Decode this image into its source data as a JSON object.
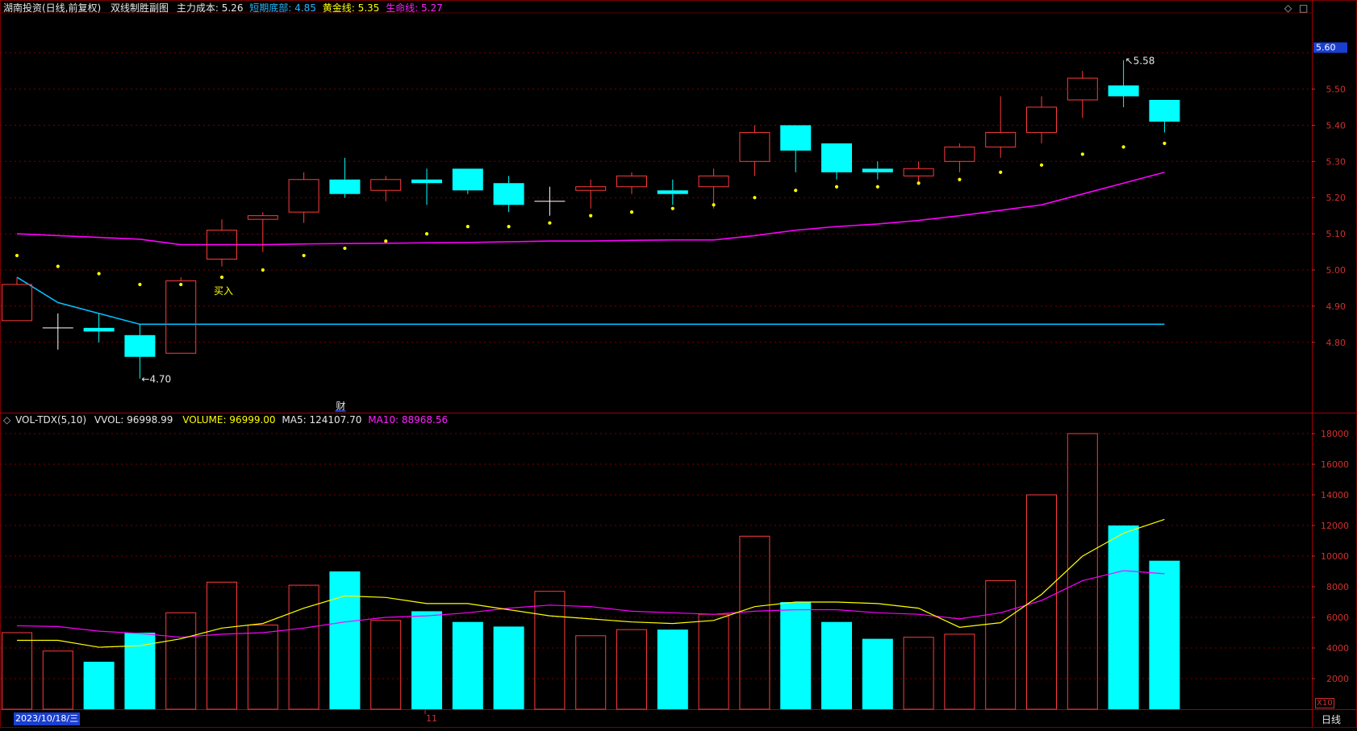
{
  "header": {
    "stock": "湖南投资(日线,前复权)",
    "indicator": "双线制胜副图",
    "cost_label": "主力成本:",
    "cost_value": "5.26",
    "bottom_label": "短期底部:",
    "bottom_value": "4.85",
    "gold_label": "黄金线:",
    "gold_value": "5.35",
    "life_label": "生命线:",
    "life_value": "5.27"
  },
  "window_controls": {
    "diamond": "◇",
    "box": "□"
  },
  "vol_header": {
    "icon": "◇",
    "name": "VOL-TDX(5,10)",
    "vvol": "VVOL: 96998.99",
    "volume": "VOLUME: 96999.00",
    "ma5": "MA5: 124107.70",
    "ma10": "MA10: 88968.56"
  },
  "footer": {
    "date_box": "2023/10/18/三",
    "month_tick": "11",
    "period": "日线",
    "multiplier": "X10"
  },
  "colors": {
    "up": "#ff3b3b",
    "down": "#00ffff",
    "life_line": "#ff00ff",
    "bottom_line": "#00bfff",
    "gold_dot": "#ffff00",
    "ma5": "#ffff00",
    "ma10": "#ff00ff",
    "grid": "#7a0000",
    "axis_text": "#d03030"
  },
  "chart_data": [
    {
      "type": "candlestick",
      "title": "双线制胜副图",
      "ylim": [
        4.7,
        5.62
      ],
      "y_ticks": [
        4.8,
        4.9,
        5.0,
        5.1,
        5.2,
        5.3,
        5.4,
        5.5
      ],
      "current_price_label": "5.60",
      "candles": [
        {
          "o": 4.86,
          "h": 4.98,
          "l": 4.86,
          "c": 4.96
        },
        {
          "o": 4.84,
          "h": 4.88,
          "l": 4.78,
          "c": 4.84
        },
        {
          "o": 4.84,
          "h": 4.88,
          "l": 4.8,
          "c": 4.83
        },
        {
          "o": 4.82,
          "h": 4.85,
          "l": 4.7,
          "c": 4.76
        },
        {
          "o": 4.77,
          "h": 4.98,
          "l": 4.77,
          "c": 4.97
        },
        {
          "o": 5.03,
          "h": 5.14,
          "l": 5.01,
          "c": 5.11
        },
        {
          "o": 5.14,
          "h": 5.16,
          "l": 5.05,
          "c": 5.15
        },
        {
          "o": 5.16,
          "h": 5.27,
          "l": 5.13,
          "c": 5.25
        },
        {
          "o": 5.25,
          "h": 5.31,
          "l": 5.2,
          "c": 5.21
        },
        {
          "o": 5.22,
          "h": 5.26,
          "l": 5.19,
          "c": 5.25
        },
        {
          "o": 5.25,
          "h": 5.28,
          "l": 5.18,
          "c": 5.24
        },
        {
          "o": 5.28,
          "h": 5.28,
          "l": 5.21,
          "c": 5.22
        },
        {
          "o": 5.24,
          "h": 5.26,
          "l": 5.16,
          "c": 5.18
        },
        {
          "o": 5.19,
          "h": 5.23,
          "l": 5.15,
          "c": 5.19
        },
        {
          "o": 5.22,
          "h": 5.25,
          "l": 5.17,
          "c": 5.23
        },
        {
          "o": 5.23,
          "h": 5.27,
          "l": 5.21,
          "c": 5.26
        },
        {
          "o": 5.22,
          "h": 5.25,
          "l": 5.18,
          "c": 5.21
        },
        {
          "o": 5.23,
          "h": 5.28,
          "l": 5.17,
          "c": 5.26
        },
        {
          "o": 5.3,
          "h": 5.4,
          "l": 5.26,
          "c": 5.38
        },
        {
          "o": 5.4,
          "h": 5.4,
          "l": 5.27,
          "c": 5.33
        },
        {
          "o": 5.35,
          "h": 5.35,
          "l": 5.25,
          "c": 5.27
        },
        {
          "o": 5.28,
          "h": 5.3,
          "l": 5.25,
          "c": 5.27
        },
        {
          "o": 5.26,
          "h": 5.3,
          "l": 5.24,
          "c": 5.28
        },
        {
          "o": 5.3,
          "h": 5.35,
          "l": 5.27,
          "c": 5.34
        },
        {
          "o": 5.34,
          "h": 5.48,
          "l": 5.31,
          "c": 5.38
        },
        {
          "o": 5.38,
          "h": 5.48,
          "l": 5.35,
          "c": 5.45
        },
        {
          "o": 5.47,
          "h": 5.55,
          "l": 5.42,
          "c": 5.53
        },
        {
          "o": 5.51,
          "h": 5.58,
          "l": 5.45,
          "c": 5.48
        },
        {
          "o": 5.47,
          "h": 5.47,
          "l": 5.38,
          "c": 5.41
        }
      ],
      "gold_dots": [
        5.04,
        5.01,
        4.99,
        4.96,
        4.96,
        4.98,
        5.0,
        5.04,
        5.06,
        5.08,
        5.1,
        5.12,
        5.12,
        5.13,
        5.15,
        5.16,
        5.17,
        5.18,
        5.2,
        5.22,
        5.23,
        5.23,
        5.24,
        5.25,
        5.27,
        5.29,
        5.32,
        5.34,
        5.35
      ],
      "life_line": [
        5.1,
        5.095,
        5.09,
        5.085,
        5.07,
        5.07,
        5.07,
        5.072,
        5.073,
        5.074,
        5.075,
        5.076,
        5.078,
        5.08,
        5.08,
        5.082,
        5.083,
        5.083,
        5.095,
        5.11,
        5.12,
        5.127,
        5.137,
        5.15,
        5.165,
        5.18,
        5.21,
        5.24,
        5.27
      ],
      "bottom_line": [
        4.98,
        4.91,
        4.88,
        4.85,
        4.85,
        4.85,
        4.85,
        4.85,
        4.85,
        4.85,
        4.85,
        4.85,
        4.85,
        4.85,
        4.85,
        4.85,
        4.85,
        4.85,
        4.85,
        4.85,
        4.85,
        4.85,
        4.85,
        4.85,
        4.85,
        4.85,
        4.85,
        4.85,
        4.85
      ],
      "annotations": {
        "low_label": "4.70",
        "high_label": "5.58",
        "buy_label": "买入",
        "cai_label": "财"
      }
    },
    {
      "type": "bar",
      "title": "VOL-TDX(5,10)",
      "ylim": [
        0,
        18600
      ],
      "y_ticks": [
        2000,
        4000,
        6000,
        8000,
        10000,
        12000,
        14000,
        16000,
        18000
      ],
      "volumes": [
        5000,
        3800,
        3100,
        5000,
        6300,
        8300,
        5500,
        8100,
        9000,
        5800,
        6400,
        5700,
        5400,
        7700,
        4800,
        5200,
        5200,
        6200,
        11300,
        7000,
        5700,
        4600,
        4700,
        4900,
        8400,
        14000,
        18000,
        12000,
        9700
      ],
      "ma5": [
        4500,
        4500,
        4050,
        4150,
        4600,
        5300,
        5600,
        6600,
        7400,
        7300,
        6900,
        6900,
        6500,
        6100,
        5900,
        5700,
        5600,
        5800,
        6700,
        7000,
        7000,
        6900,
        6600,
        5350,
        5650,
        7500,
        10000,
        11500,
        12400
      ],
      "ma10": [
        5450,
        5400,
        5100,
        4950,
        4700,
        4900,
        5000,
        5300,
        5700,
        6000,
        6100,
        6300,
        6600,
        6800,
        6700,
        6400,
        6300,
        6200,
        6400,
        6500,
        6500,
        6300,
        6200,
        5900,
        6300,
        7100,
        8400,
        9050,
        8850
      ]
    }
  ]
}
